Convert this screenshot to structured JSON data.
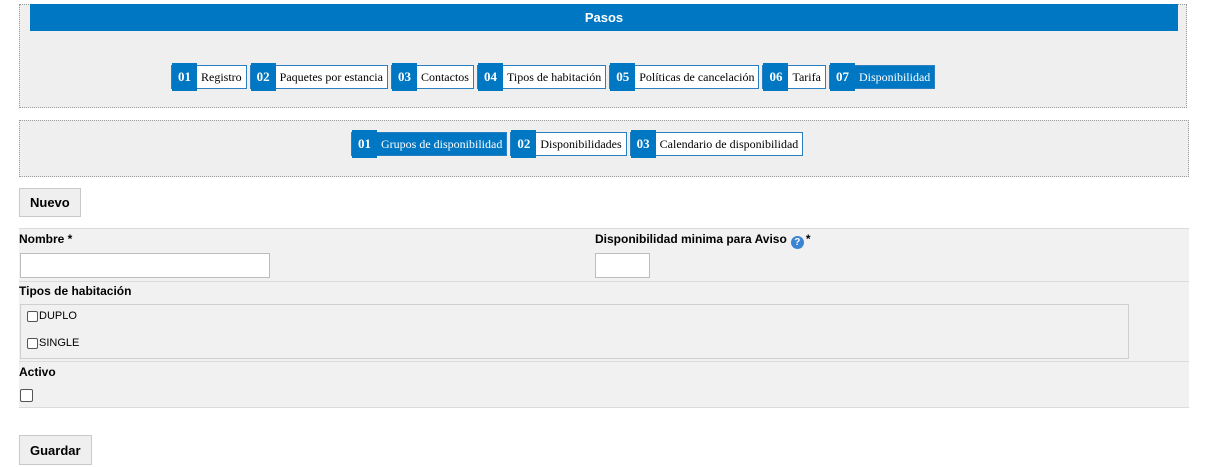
{
  "steps": {
    "title": "Pasos",
    "tabs": [
      {
        "num": "01",
        "label": "Registro",
        "active": false
      },
      {
        "num": "02",
        "label": "Paquetes por estancia",
        "active": false
      },
      {
        "num": "03",
        "label": "Contactos",
        "active": false
      },
      {
        "num": "04",
        "label": "Tipos de habitación",
        "active": false
      },
      {
        "num": "05",
        "label": "Políticas de cancelación",
        "active": false
      },
      {
        "num": "06",
        "label": "Tarifa",
        "active": false
      },
      {
        "num": "07",
        "label": "Disponibilidad",
        "active": true
      }
    ]
  },
  "subtabs": [
    {
      "num": "01",
      "label": "Grupos de disponibilidad",
      "active": true
    },
    {
      "num": "02",
      "label": "Disponibilidades",
      "active": false
    },
    {
      "num": "03",
      "label": "Calendario de disponibilidad",
      "active": false
    }
  ],
  "toolbar": {
    "new_label": "Nuevo"
  },
  "form": {
    "nombre_label": "Nombre *",
    "nombre_value": "",
    "disp_label": "Disponibilidad minima para Aviso",
    "disp_required": "*",
    "disp_help_icon": "question-circle-icon",
    "disp_value": "",
    "tipos_label": "Tipos de habitación",
    "tipos": [
      {
        "label": "DUPLO",
        "checked": false
      },
      {
        "label": "SINGLE",
        "checked": false
      }
    ],
    "activo_label": "Activo",
    "activo_checked": false,
    "save_label": "Guardar"
  },
  "colors": {
    "accent": "#0077c2",
    "panel": "#efefef"
  }
}
